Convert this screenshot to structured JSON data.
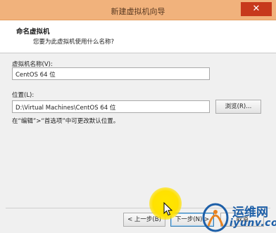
{
  "window": {
    "title": "新建虚拟机向导",
    "close_symbol": "✕"
  },
  "header": {
    "title": "命名虚拟机",
    "subtitle": "您要为此虚拟机使用什么名称?"
  },
  "form": {
    "name_label": "虚拟机名称(V):",
    "name_value": "CentOS 64 位",
    "location_label": "位置(L):",
    "location_value": "D:\\Virtual Machines\\CentOS 64 位",
    "browse_label": "浏览(R)...",
    "hint": "在“编辑”>“首选项”中可更改默认位置。"
  },
  "footer": {
    "back_label": "< 上一步(B)",
    "next_label": "下一步(N) >",
    "cancel_label": "取消"
  },
  "watermark": {
    "line1": "运维网",
    "line2": "iyunv.com"
  },
  "colors": {
    "titlebar": "#f1b27c",
    "close": "#c7391c",
    "cursor_highlight": "#ffe600",
    "watermark": "#1d5fa8"
  }
}
